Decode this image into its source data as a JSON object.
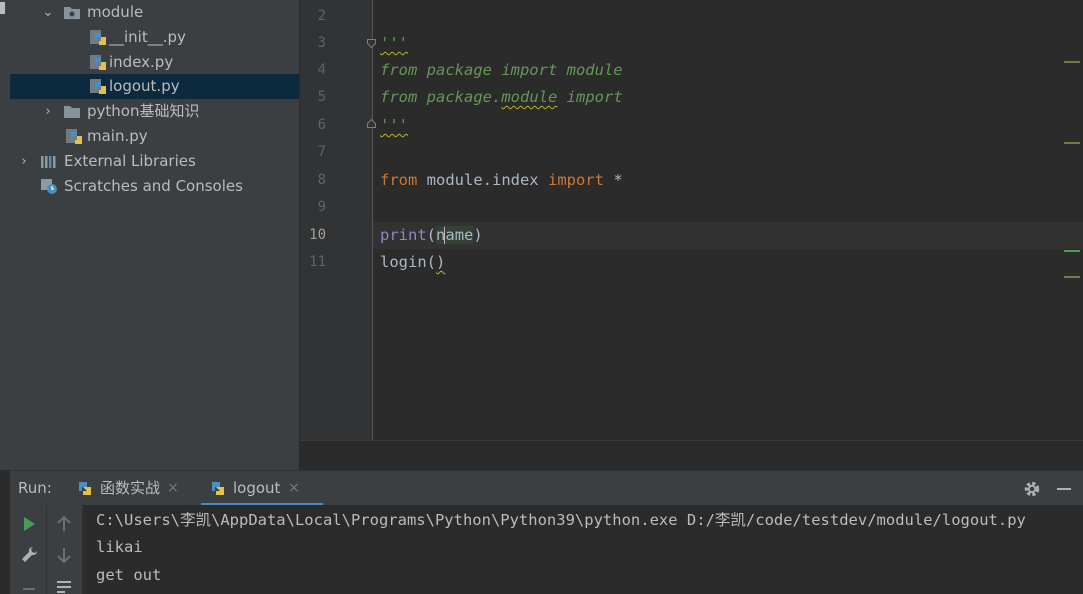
{
  "project_tree": {
    "items": [
      {
        "label": "module",
        "type": "folder",
        "expanded": true,
        "icon": "folder-dot-icon"
      },
      {
        "label": "__init__.py",
        "type": "python-file",
        "icon": "python-file-icon"
      },
      {
        "label": "index.py",
        "type": "python-file",
        "icon": "python-file-icon"
      },
      {
        "label": "logout.py",
        "type": "python-file",
        "icon": "python-file-icon",
        "selected": true
      },
      {
        "label": "python基础知识",
        "type": "folder",
        "expanded": false,
        "icon": "folder-icon"
      },
      {
        "label": "main.py",
        "type": "python-file",
        "icon": "python-file-icon"
      },
      {
        "label": "External Libraries",
        "type": "libraries",
        "expanded": false,
        "icon": "libraries-icon"
      },
      {
        "label": "Scratches and Consoles",
        "type": "scratches",
        "icon": "scratches-icon"
      }
    ]
  },
  "editor": {
    "line_numbers": [
      "2",
      "3",
      "4",
      "5",
      "6",
      "7",
      "8",
      "9",
      "10",
      "11"
    ],
    "current_line": "10",
    "code": {
      "line3": "'''",
      "line4": "from package import module",
      "line5_a": "from package.",
      "line5_b": "module",
      "line5_c": " import",
      "line6": "'''",
      "line8_from": "from",
      "line8_mid": " module.index ",
      "line8_import": "import",
      "line8_star": " *",
      "line10_print": "print",
      "line10_open": "(",
      "line10_n": "n",
      "line10_ame": "ame",
      "line10_close": ")",
      "line11_fn": "login(",
      "line11_close": ")"
    }
  },
  "run_panel": {
    "title": "Run:",
    "tabs": [
      {
        "label": "函数实战",
        "active": false
      },
      {
        "label": "logout",
        "active": true
      }
    ],
    "close_glyph": "×",
    "console_lines": [
      "C:\\Users\\李凯\\AppData\\Local\\Programs\\Python\\Python39\\python.exe D:/李凯/code/testdev/module/logout.py",
      "likai",
      "get out"
    ]
  },
  "colors": {
    "selection": "#0d293e",
    "docstring": "#629755",
    "keyword": "#cc7832",
    "builtin": "#8888c6",
    "run_green": "#499c54",
    "tab_underline": "#4a88c7"
  }
}
